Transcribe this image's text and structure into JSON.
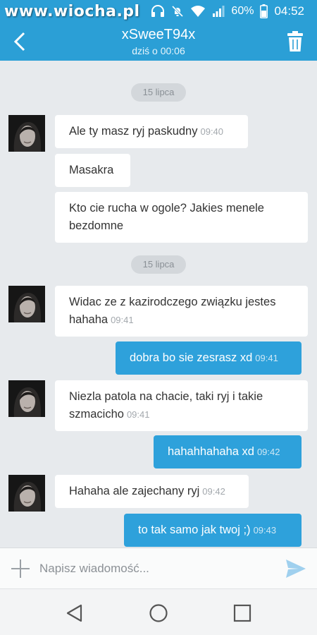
{
  "watermark": "www.wiocha.pl",
  "status_bar": {
    "icons": [
      "headphones-icon",
      "mute-icon",
      "wifi-icon",
      "signal-icon",
      "battery-icon"
    ],
    "battery_percent": "60%",
    "time": "04:52"
  },
  "header": {
    "title": "xSweeT94x",
    "subtitle": "dziś o 00:06",
    "back_icon": "chevron-left-icon",
    "trash_icon": "trash-icon"
  },
  "messages": [
    {
      "type": "date",
      "label": "15 lipca"
    },
    {
      "type": "incoming",
      "text": "Ale ty masz ryj paskudny",
      "time": "09:40",
      "avatar": true
    },
    {
      "type": "incoming",
      "text": "Masakra",
      "time": ""
    },
    {
      "type": "incoming",
      "text": "Kto cie rucha w ogole? Jakies menele bezdomne",
      "time": ""
    },
    {
      "type": "date",
      "label": "15 lipca"
    },
    {
      "type": "incoming",
      "text": "Widac ze z kazirodczego związku jestes hahaha",
      "time": "09:41",
      "avatar": true
    },
    {
      "type": "outgoing",
      "text": "dobra bo sie zesrasz xd",
      "time": "09:41"
    },
    {
      "type": "incoming",
      "text": "Niezla patola na chacie, taki ryj i takie szmacicho",
      "time": "09:41",
      "avatar": true
    },
    {
      "type": "outgoing",
      "text": "hahahhahaha xd",
      "time": "09:42"
    },
    {
      "type": "incoming",
      "text": "Hahaha ale zajechany ryj",
      "time": "09:42",
      "avatar": true
    },
    {
      "type": "outgoing",
      "text": "to tak samo jak twoj ;)",
      "time": "09:43"
    }
  ],
  "composer": {
    "placeholder": "Napisz wiadomość...",
    "plus_icon": "plus-icon",
    "send_icon": "send-icon"
  },
  "nav": {
    "icons": [
      "back-triangle-icon",
      "home-circle-icon",
      "recents-square-icon"
    ]
  },
  "colors": {
    "header": "#2b9fd6",
    "outgoing_bubble": "#2ea1db",
    "background": "#e7eaed"
  }
}
